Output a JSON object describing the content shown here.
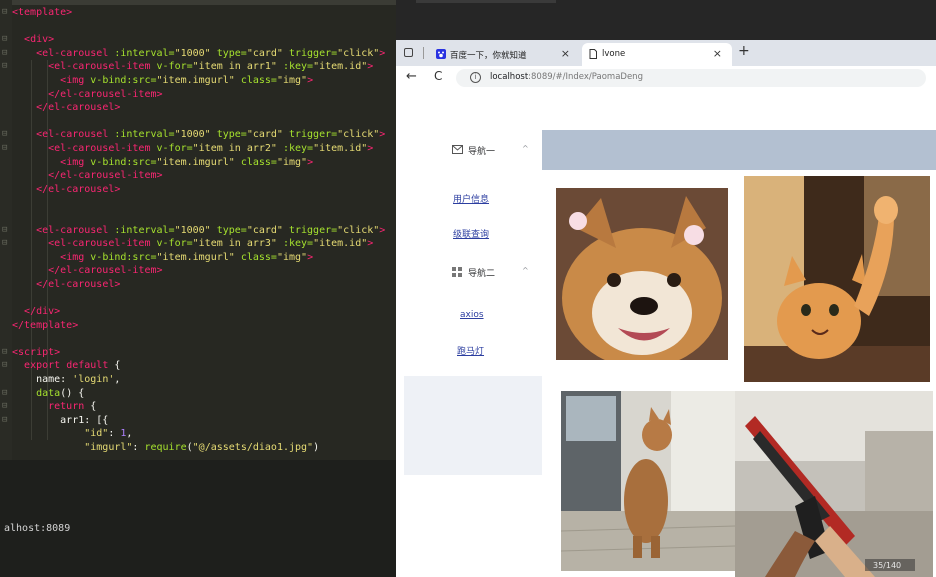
{
  "editor": {
    "lines": [
      {
        "fold": "⊟",
        "tokens": [
          {
            "t": "<template>",
            "c": "c-tag"
          }
        ]
      },
      {
        "fold": "",
        "tokens": []
      },
      {
        "fold": "⊟",
        "tokens": [
          {
            "t": "  "
          },
          {
            "t": "<div>",
            "c": "c-tag"
          }
        ]
      },
      {
        "fold": "⊟",
        "tokens": [
          {
            "t": "    "
          },
          {
            "t": "<el-carousel",
            "c": "c-tag"
          },
          {
            "t": " :interval=",
            "c": "c-attr"
          },
          {
            "t": "\"1000\"",
            "c": "c-str"
          },
          {
            "t": " type=",
            "c": "c-attr"
          },
          {
            "t": "\"card\"",
            "c": "c-str"
          },
          {
            "t": " trigger=",
            "c": "c-attr"
          },
          {
            "t": "\"click\"",
            "c": "c-str"
          },
          {
            "t": ">",
            "c": "c-tag"
          }
        ]
      },
      {
        "fold": "⊟",
        "tokens": [
          {
            "t": "      "
          },
          {
            "t": "<el-carousel-item",
            "c": "c-tag"
          },
          {
            "t": " v-for=",
            "c": "c-attr"
          },
          {
            "t": "\"item in arr1\"",
            "c": "c-str"
          },
          {
            "t": " :key=",
            "c": "c-attr"
          },
          {
            "t": "\"item.id\"",
            "c": "c-str"
          },
          {
            "t": ">",
            "c": "c-tag"
          }
        ]
      },
      {
        "fold": "",
        "tokens": [
          {
            "t": "        "
          },
          {
            "t": "<img",
            "c": "c-tag"
          },
          {
            "t": " v-bind:src=",
            "c": "c-attr"
          },
          {
            "t": "\"item.imgurl\"",
            "c": "c-str"
          },
          {
            "t": " class=",
            "c": "c-attr"
          },
          {
            "t": "\"img\"",
            "c": "c-str"
          },
          {
            "t": ">",
            "c": "c-tag"
          }
        ]
      },
      {
        "fold": "",
        "tokens": [
          {
            "t": "      "
          },
          {
            "t": "</el-carousel-item>",
            "c": "c-tag"
          }
        ]
      },
      {
        "fold": "",
        "tokens": [
          {
            "t": "    "
          },
          {
            "t": "</el-carousel>",
            "c": "c-tag"
          }
        ]
      },
      {
        "fold": "",
        "tokens": []
      },
      {
        "fold": "⊟",
        "tokens": [
          {
            "t": "    "
          },
          {
            "t": "<el-carousel",
            "c": "c-tag"
          },
          {
            "t": " :interval=",
            "c": "c-attr"
          },
          {
            "t": "\"1000\"",
            "c": "c-str"
          },
          {
            "t": " type=",
            "c": "c-attr"
          },
          {
            "t": "\"card\"",
            "c": "c-str"
          },
          {
            "t": " trigger=",
            "c": "c-attr"
          },
          {
            "t": "\"click\"",
            "c": "c-str"
          },
          {
            "t": ">",
            "c": "c-tag"
          }
        ]
      },
      {
        "fold": "⊟",
        "tokens": [
          {
            "t": "      "
          },
          {
            "t": "<el-carousel-item",
            "c": "c-tag"
          },
          {
            "t": " v-for=",
            "c": "c-attr"
          },
          {
            "t": "\"item in arr2\"",
            "c": "c-str"
          },
          {
            "t": " :key=",
            "c": "c-attr"
          },
          {
            "t": "\"item.id\"",
            "c": "c-str"
          },
          {
            "t": ">",
            "c": "c-tag"
          }
        ]
      },
      {
        "fold": "",
        "tokens": [
          {
            "t": "        "
          },
          {
            "t": "<img",
            "c": "c-tag"
          },
          {
            "t": " v-bind:src=",
            "c": "c-attr"
          },
          {
            "t": "\"item.imgurl\"",
            "c": "c-str"
          },
          {
            "t": " class=",
            "c": "c-attr"
          },
          {
            "t": "\"img\"",
            "c": "c-str"
          },
          {
            "t": ">",
            "c": "c-tag"
          }
        ]
      },
      {
        "fold": "",
        "tokens": [
          {
            "t": "      "
          },
          {
            "t": "</el-carousel-item>",
            "c": "c-tag"
          }
        ]
      },
      {
        "fold": "",
        "tokens": [
          {
            "t": "    "
          },
          {
            "t": "</el-carousel>",
            "c": "c-tag"
          }
        ]
      },
      {
        "fold": "",
        "tokens": []
      },
      {
        "fold": "",
        "tokens": []
      },
      {
        "fold": "⊟",
        "tokens": [
          {
            "t": "    "
          },
          {
            "t": "<el-carousel",
            "c": "c-tag"
          },
          {
            "t": " :interval=",
            "c": "c-attr"
          },
          {
            "t": "\"1000\"",
            "c": "c-str"
          },
          {
            "t": " type=",
            "c": "c-attr"
          },
          {
            "t": "\"card\"",
            "c": "c-str"
          },
          {
            "t": " trigger=",
            "c": "c-attr"
          },
          {
            "t": "\"click\"",
            "c": "c-str"
          },
          {
            "t": ">",
            "c": "c-tag"
          }
        ]
      },
      {
        "fold": "⊟",
        "tokens": [
          {
            "t": "      "
          },
          {
            "t": "<el-carousel-item",
            "c": "c-tag"
          },
          {
            "t": " v-for=",
            "c": "c-attr"
          },
          {
            "t": "\"item in arr3\"",
            "c": "c-str"
          },
          {
            "t": " :key=",
            "c": "c-attr"
          },
          {
            "t": "\"item.id\"",
            "c": "c-str"
          },
          {
            "t": ">",
            "c": "c-tag"
          }
        ]
      },
      {
        "fold": "",
        "tokens": [
          {
            "t": "        "
          },
          {
            "t": "<img",
            "c": "c-tag"
          },
          {
            "t": " v-bind:src=",
            "c": "c-attr"
          },
          {
            "t": "\"item.imgurl\"",
            "c": "c-str"
          },
          {
            "t": " class=",
            "c": "c-attr"
          },
          {
            "t": "\"img\"",
            "c": "c-str"
          },
          {
            "t": ">",
            "c": "c-tag"
          }
        ]
      },
      {
        "fold": "",
        "tokens": [
          {
            "t": "      "
          },
          {
            "t": "</el-carousel-item>",
            "c": "c-tag"
          }
        ]
      },
      {
        "fold": "",
        "tokens": [
          {
            "t": "    "
          },
          {
            "t": "</el-carousel>",
            "c": "c-tag"
          }
        ]
      },
      {
        "fold": "",
        "tokens": []
      },
      {
        "fold": "",
        "tokens": [
          {
            "t": "  "
          },
          {
            "t": "</div>",
            "c": "c-tag"
          }
        ]
      },
      {
        "fold": "",
        "tokens": [
          {
            "t": "</template>",
            "c": "c-tag"
          }
        ]
      },
      {
        "fold": "",
        "tokens": []
      },
      {
        "fold": "⊟",
        "tokens": [
          {
            "t": "<script>",
            "c": "c-tag"
          }
        ]
      },
      {
        "fold": "⊟",
        "tokens": [
          {
            "t": "  "
          },
          {
            "t": "export default",
            "c": "c-kw"
          },
          {
            "t": " {"
          }
        ]
      },
      {
        "fold": "",
        "tokens": [
          {
            "t": "    name: "
          },
          {
            "t": "'login'",
            "c": "c-str"
          },
          {
            "t": ","
          }
        ]
      },
      {
        "fold": "⊟",
        "tokens": [
          {
            "t": "    "
          },
          {
            "t": "data",
            "c": "c-attr"
          },
          {
            "t": "() {"
          }
        ]
      },
      {
        "fold": "⊟",
        "tokens": [
          {
            "t": "      "
          },
          {
            "t": "return",
            "c": "c-kw"
          },
          {
            "t": " {"
          }
        ]
      },
      {
        "fold": "⊟",
        "tokens": [
          {
            "t": "        arr1: [{"
          }
        ]
      },
      {
        "fold": "",
        "tokens": [
          {
            "t": "            "
          },
          {
            "t": "\"id\"",
            "c": "c-str"
          },
          {
            "t": ": "
          },
          {
            "t": "1",
            "c": "c-num"
          },
          {
            "t": ","
          }
        ]
      },
      {
        "fold": "",
        "tokens": [
          {
            "t": "            "
          },
          {
            "t": "\"imgurl\"",
            "c": "c-str"
          },
          {
            "t": ": "
          },
          {
            "t": "require",
            "c": "c-attr"
          },
          {
            "t": "("
          },
          {
            "t": "\"@/assets/diao1.jpg\"",
            "c": "c-str"
          },
          {
            "t": ")"
          }
        ]
      }
    ]
  },
  "terminal": {
    "text": "alhost:8089"
  },
  "browser": {
    "tabs": [
      {
        "label": "百度一下，你就知道",
        "close": "×"
      },
      {
        "label": "lvone",
        "close": "×"
      }
    ],
    "new_tab": "+",
    "nav": {
      "back": "←",
      "reload": "C"
    },
    "url_host": "localhost",
    "url_path": ":8089/#/Index/PaomaDeng"
  },
  "sidebar": {
    "group1": {
      "label": "导航一",
      "arrow": "^"
    },
    "group1_items": [
      "用户信息",
      "级联查询"
    ],
    "group2": {
      "label": "导航二",
      "arrow": "^"
    },
    "group2_items": [
      "axios",
      "跑马灯"
    ]
  },
  "images": {
    "shiba": "shiba-dog-photo",
    "cat_waving": "cat-waving-photo",
    "cat_standing": "cat-standing-photo",
    "rifle": "rifle-game-screenshot",
    "rifle_hud": "35/140"
  }
}
